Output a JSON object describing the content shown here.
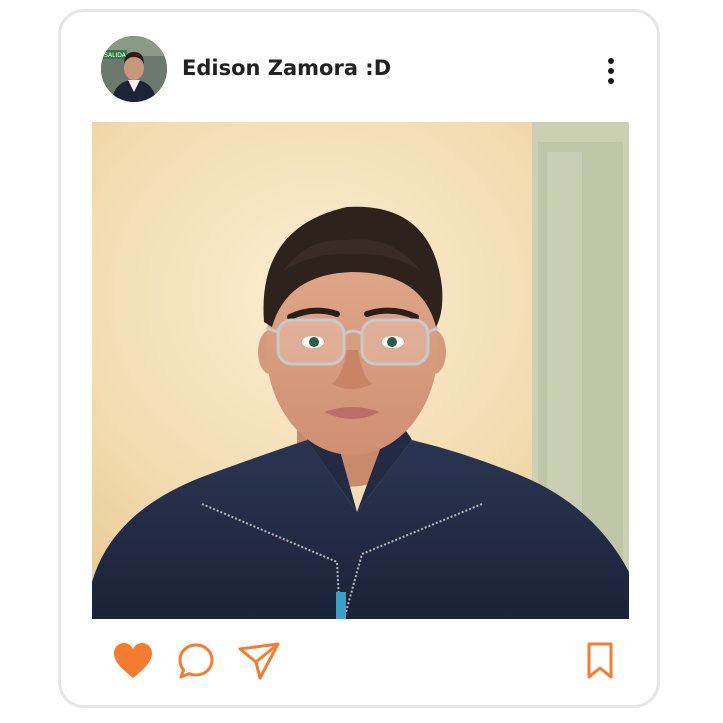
{
  "post": {
    "username": "Edison Zamora :D",
    "avatar_sign_text": "SALIDA"
  },
  "icons": {
    "more": "more-vertical-icon",
    "like": "heart-icon",
    "comment": "comment-bubble-icon",
    "share": "paper-plane-icon",
    "save": "bookmark-icon"
  },
  "colors": {
    "accent": "#f37c30",
    "text": "#222222",
    "border": "#e6e6e6"
  }
}
